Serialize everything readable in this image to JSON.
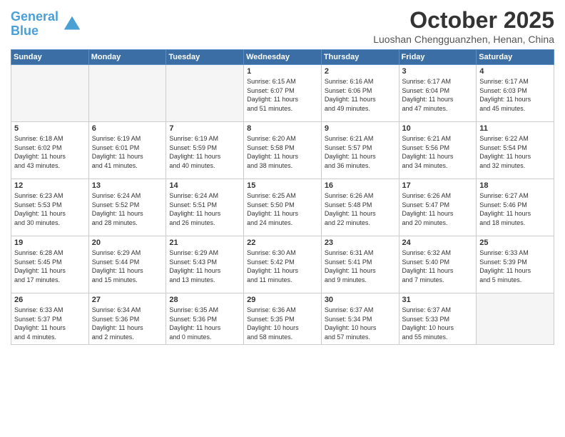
{
  "header": {
    "logo_line1": "General",
    "logo_line2": "Blue",
    "month": "October 2025",
    "location": "Luoshan Chengguanzhen, Henan, China"
  },
  "days_of_week": [
    "Sunday",
    "Monday",
    "Tuesday",
    "Wednesday",
    "Thursday",
    "Friday",
    "Saturday"
  ],
  "weeks": [
    [
      {
        "num": "",
        "info": ""
      },
      {
        "num": "",
        "info": ""
      },
      {
        "num": "",
        "info": ""
      },
      {
        "num": "1",
        "info": "Sunrise: 6:15 AM\nSunset: 6:07 PM\nDaylight: 11 hours\nand 51 minutes."
      },
      {
        "num": "2",
        "info": "Sunrise: 6:16 AM\nSunset: 6:06 PM\nDaylight: 11 hours\nand 49 minutes."
      },
      {
        "num": "3",
        "info": "Sunrise: 6:17 AM\nSunset: 6:04 PM\nDaylight: 11 hours\nand 47 minutes."
      },
      {
        "num": "4",
        "info": "Sunrise: 6:17 AM\nSunset: 6:03 PM\nDaylight: 11 hours\nand 45 minutes."
      }
    ],
    [
      {
        "num": "5",
        "info": "Sunrise: 6:18 AM\nSunset: 6:02 PM\nDaylight: 11 hours\nand 43 minutes."
      },
      {
        "num": "6",
        "info": "Sunrise: 6:19 AM\nSunset: 6:01 PM\nDaylight: 11 hours\nand 41 minutes."
      },
      {
        "num": "7",
        "info": "Sunrise: 6:19 AM\nSunset: 5:59 PM\nDaylight: 11 hours\nand 40 minutes."
      },
      {
        "num": "8",
        "info": "Sunrise: 6:20 AM\nSunset: 5:58 PM\nDaylight: 11 hours\nand 38 minutes."
      },
      {
        "num": "9",
        "info": "Sunrise: 6:21 AM\nSunset: 5:57 PM\nDaylight: 11 hours\nand 36 minutes."
      },
      {
        "num": "10",
        "info": "Sunrise: 6:21 AM\nSunset: 5:56 PM\nDaylight: 11 hours\nand 34 minutes."
      },
      {
        "num": "11",
        "info": "Sunrise: 6:22 AM\nSunset: 5:54 PM\nDaylight: 11 hours\nand 32 minutes."
      }
    ],
    [
      {
        "num": "12",
        "info": "Sunrise: 6:23 AM\nSunset: 5:53 PM\nDaylight: 11 hours\nand 30 minutes."
      },
      {
        "num": "13",
        "info": "Sunrise: 6:24 AM\nSunset: 5:52 PM\nDaylight: 11 hours\nand 28 minutes."
      },
      {
        "num": "14",
        "info": "Sunrise: 6:24 AM\nSunset: 5:51 PM\nDaylight: 11 hours\nand 26 minutes."
      },
      {
        "num": "15",
        "info": "Sunrise: 6:25 AM\nSunset: 5:50 PM\nDaylight: 11 hours\nand 24 minutes."
      },
      {
        "num": "16",
        "info": "Sunrise: 6:26 AM\nSunset: 5:48 PM\nDaylight: 11 hours\nand 22 minutes."
      },
      {
        "num": "17",
        "info": "Sunrise: 6:26 AM\nSunset: 5:47 PM\nDaylight: 11 hours\nand 20 minutes."
      },
      {
        "num": "18",
        "info": "Sunrise: 6:27 AM\nSunset: 5:46 PM\nDaylight: 11 hours\nand 18 minutes."
      }
    ],
    [
      {
        "num": "19",
        "info": "Sunrise: 6:28 AM\nSunset: 5:45 PM\nDaylight: 11 hours\nand 17 minutes."
      },
      {
        "num": "20",
        "info": "Sunrise: 6:29 AM\nSunset: 5:44 PM\nDaylight: 11 hours\nand 15 minutes."
      },
      {
        "num": "21",
        "info": "Sunrise: 6:29 AM\nSunset: 5:43 PM\nDaylight: 11 hours\nand 13 minutes."
      },
      {
        "num": "22",
        "info": "Sunrise: 6:30 AM\nSunset: 5:42 PM\nDaylight: 11 hours\nand 11 minutes."
      },
      {
        "num": "23",
        "info": "Sunrise: 6:31 AM\nSunset: 5:41 PM\nDaylight: 11 hours\nand 9 minutes."
      },
      {
        "num": "24",
        "info": "Sunrise: 6:32 AM\nSunset: 5:40 PM\nDaylight: 11 hours\nand 7 minutes."
      },
      {
        "num": "25",
        "info": "Sunrise: 6:33 AM\nSunset: 5:39 PM\nDaylight: 11 hours\nand 5 minutes."
      }
    ],
    [
      {
        "num": "26",
        "info": "Sunrise: 6:33 AM\nSunset: 5:37 PM\nDaylight: 11 hours\nand 4 minutes."
      },
      {
        "num": "27",
        "info": "Sunrise: 6:34 AM\nSunset: 5:36 PM\nDaylight: 11 hours\nand 2 minutes."
      },
      {
        "num": "28",
        "info": "Sunrise: 6:35 AM\nSunset: 5:36 PM\nDaylight: 11 hours\nand 0 minutes."
      },
      {
        "num": "29",
        "info": "Sunrise: 6:36 AM\nSunset: 5:35 PM\nDaylight: 10 hours\nand 58 minutes."
      },
      {
        "num": "30",
        "info": "Sunrise: 6:37 AM\nSunset: 5:34 PM\nDaylight: 10 hours\nand 57 minutes."
      },
      {
        "num": "31",
        "info": "Sunrise: 6:37 AM\nSunset: 5:33 PM\nDaylight: 10 hours\nand 55 minutes."
      },
      {
        "num": "",
        "info": ""
      }
    ]
  ]
}
